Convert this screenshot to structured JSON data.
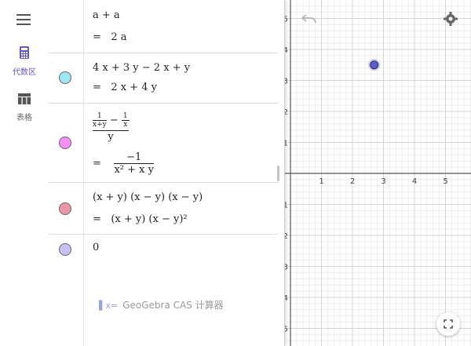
{
  "rail": {
    "menu_icon": "hamburger-icon",
    "items": [
      {
        "icon": "calculator-icon",
        "label": "代数区",
        "active": true
      },
      {
        "icon": "table-icon",
        "label": "表格",
        "active": false
      }
    ]
  },
  "cas": {
    "rows": [
      {
        "input": "a + a",
        "eq": "=",
        "output": "2 a",
        "color": ""
      },
      {
        "input": "4 x + 3 y − 2 x + y",
        "eq": "=",
        "output": "2 x + 4 y",
        "color": "#9de7f3"
      },
      {
        "input_num_num": "1",
        "input_num_den": "x+y",
        "input_minus": "−",
        "input_num2_num": "1",
        "input_num2_den": "x",
        "input_den": "y",
        "eq": "=",
        "output_num": "−1",
        "output_den": "x² + x y",
        "color": "#f58ef5"
      },
      {
        "input": "(x + y) (x − y) (x − y)",
        "eq": "=",
        "output": "(x + y) (x − y)²",
        "color": "#ea95a8"
      },
      {
        "input": "0",
        "color": "#c7c1f2"
      }
    ],
    "footer_label": "GeoGebra CAS 计算器",
    "footer_icon": "x-equals-icon"
  },
  "graph": {
    "x_ticks": [
      "1",
      "2",
      "3",
      "4",
      "5"
    ],
    "y_ticks": [
      "5",
      "4",
      "3",
      "2",
      "1",
      "−1",
      "−2",
      "−3",
      "−4",
      "−5"
    ],
    "point": {
      "x": 2.7,
      "y": 3.5,
      "color": "#5b5bd6"
    },
    "undo_icon": "undo-icon",
    "settings_icon": "gear-icon",
    "fullscreen_icon": "fullscreen-icon"
  }
}
